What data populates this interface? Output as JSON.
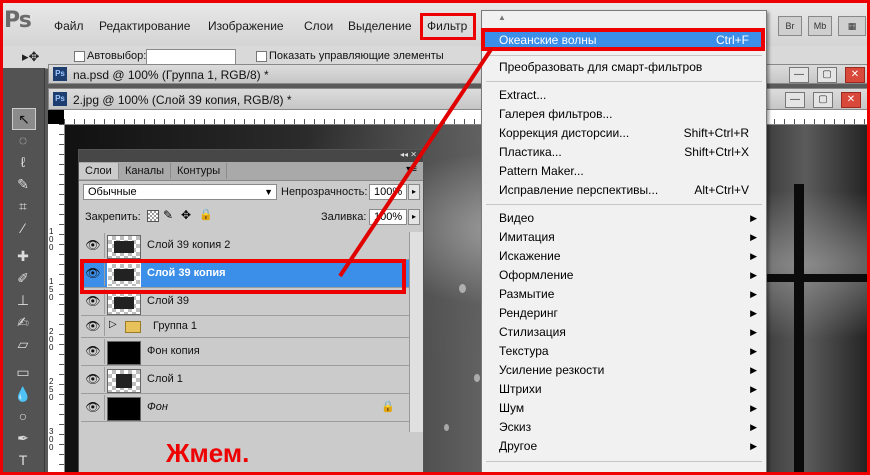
{
  "app": {
    "logo": "Ps"
  },
  "menubar": {
    "items": [
      "Файл",
      "Редактирование",
      "Изображение",
      "Слои",
      "Выделение",
      "Фильтр"
    ],
    "right_buttons": [
      "Br",
      "Mb"
    ]
  },
  "options": {
    "auto_select": "Автовыбор:",
    "show_transform": "Показать управляющие элементы"
  },
  "documents": [
    {
      "title": "na.psd @ 100% (Группа 1, RGB/8) *"
    },
    {
      "title": "2.jpg @ 100% (Слой 39 копия, RGB/8) *"
    }
  ],
  "rulers": {
    "left_numbers": [
      "1\n0\n0",
      "1\n5\n0",
      "2\n0\n0",
      "2\n5\n0",
      "3\n0\n0",
      "3\n5\n0",
      "4\n0\n0"
    ]
  },
  "layers_panel": {
    "tabs": [
      "Слои",
      "Каналы",
      "Контуры"
    ],
    "blend_mode": "Обычные",
    "opacity_label": "Непрозрачность:",
    "opacity_value": "100%",
    "lock_label": "Закрепить:",
    "fill_label": "Заливка:",
    "fill_value": "100%",
    "layers": [
      {
        "name": "Слой 39 копия 2"
      },
      {
        "name": "Слой 39 копия",
        "selected": true
      },
      {
        "name": "Слой 39"
      },
      {
        "name": "Группа 1"
      },
      {
        "name": "Фон копия"
      },
      {
        "name": "Слой 1"
      },
      {
        "name": "Фон"
      }
    ]
  },
  "annotation": {
    "text": "Жмем."
  },
  "filter_menu": {
    "items": [
      {
        "label": "Океанские волны",
        "shortcut": "Ctrl+F"
      },
      {
        "label": "Преобразовать для смарт-фильтров"
      },
      {
        "label": "Extract..."
      },
      {
        "label": "Галерея фильтров..."
      },
      {
        "label": "Коррекция дисторсии...",
        "shortcut": "Shift+Ctrl+R"
      },
      {
        "label": "Пластика...",
        "shortcut": "Shift+Ctrl+X"
      },
      {
        "label": "Pattern Maker..."
      },
      {
        "label": "Исправление перспективы...",
        "shortcut": "Alt+Ctrl+V"
      },
      {
        "label": "Видео"
      },
      {
        "label": "Имитация"
      },
      {
        "label": "Искажение"
      },
      {
        "label": "Оформление"
      },
      {
        "label": "Размытие"
      },
      {
        "label": "Рендеринг"
      },
      {
        "label": "Стилизация"
      },
      {
        "label": "Текстура"
      },
      {
        "label": "Усиление резкости"
      },
      {
        "label": "Штрихи"
      },
      {
        "label": "Шум"
      },
      {
        "label": "Эскиз"
      },
      {
        "label": "Другое"
      }
    ]
  },
  "colors": {
    "highlight": "#3b8fe8",
    "annotation_red": "#e00000"
  }
}
